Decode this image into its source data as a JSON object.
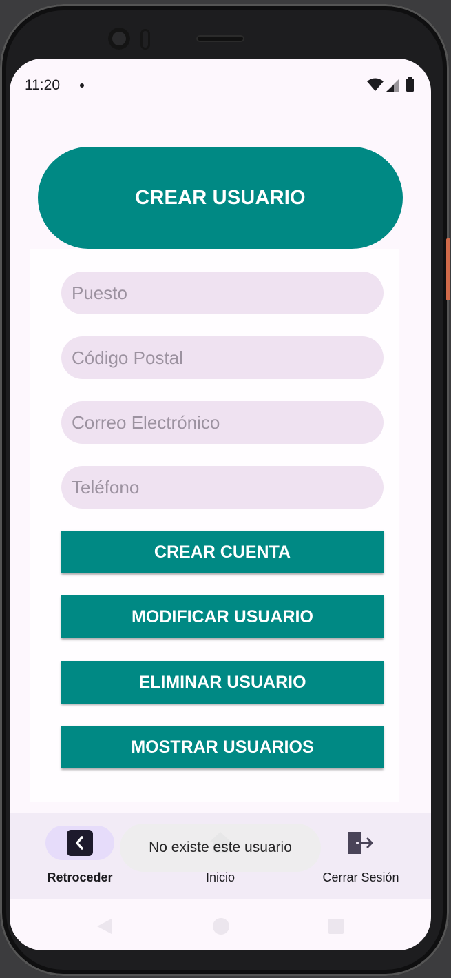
{
  "status_bar": {
    "time": "11:20"
  },
  "header": {
    "title": "CREAR USUARIO"
  },
  "form": {
    "fields": [
      {
        "placeholder": "Puesto",
        "value": ""
      },
      {
        "placeholder": "Código Postal",
        "value": ""
      },
      {
        "placeholder": "Correo Electrónico",
        "value": ""
      },
      {
        "placeholder": "Teléfono",
        "value": ""
      }
    ],
    "buttons": [
      {
        "label": "CREAR CUENTA"
      },
      {
        "label": "MODIFICAR USUARIO"
      },
      {
        "label": "ELIMINAR USUARIO"
      },
      {
        "label": "MOSTRAR USUARIOS"
      }
    ]
  },
  "bottom_nav": {
    "items": [
      {
        "label": "Retroceder",
        "icon": "back-chevron-icon",
        "active": true
      },
      {
        "label": "Inicio",
        "icon": "home-icon",
        "active": false
      },
      {
        "label": "Cerrar Sesión",
        "icon": "logout-icon",
        "active": false
      }
    ]
  },
  "toast": {
    "message": "No existe este usuario"
  },
  "colors": {
    "primary": "#008984",
    "input_bg": "#efe2f1",
    "nav_bg": "#f2ebf6",
    "active_indicator": "#e6dcfa",
    "screen_bg": "#fdf7fd"
  }
}
